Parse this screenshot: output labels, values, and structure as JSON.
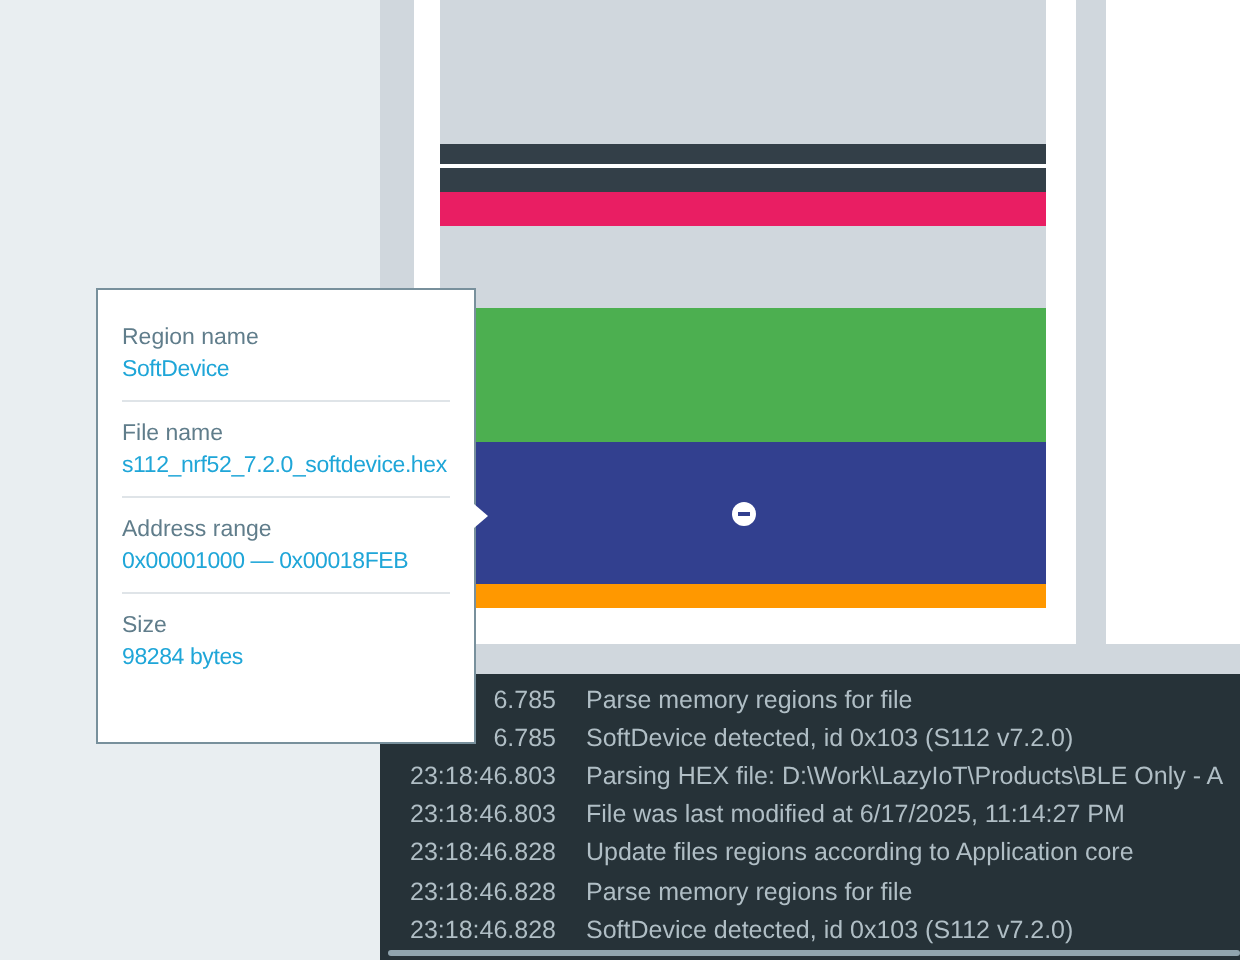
{
  "memory_map": {
    "regions": [
      {
        "kind": "gap",
        "color": "#d0d7dd"
      },
      {
        "kind": "region",
        "color": "#333f48"
      },
      {
        "kind": "region",
        "color": "#333f48"
      },
      {
        "kind": "region",
        "color": "#e91e63"
      },
      {
        "kind": "gap",
        "color": "#d0d7dd"
      },
      {
        "kind": "region",
        "color": "#4caf50"
      },
      {
        "kind": "region",
        "color": "#32408f",
        "selected": true
      },
      {
        "kind": "region",
        "color": "#ff9800"
      },
      {
        "kind": "gap",
        "color": "#ffffff"
      }
    ]
  },
  "tooltip": {
    "fields": [
      {
        "label": "Region name",
        "value": "SoftDevice"
      },
      {
        "label": "File name",
        "value": "s112_nrf52_7.2.0_softdevice.hex"
      },
      {
        "label": "Address range",
        "value": "0x00001000 — 0x00018FEB"
      },
      {
        "label": "Size",
        "value": "98284 bytes"
      }
    ]
  },
  "log": {
    "rows": [
      {
        "time": "6.785",
        "message": "Parse memory regions for file"
      },
      {
        "time": "6.785",
        "message": "SoftDevice detected, id 0x103 (S112 v7.2.0)"
      },
      {
        "time": "23:18:46.803",
        "message": "Parsing HEX file: D:\\Work\\LazyIoT\\Products\\BLE Only - A"
      },
      {
        "time": "23:18:46.803",
        "message": "File was last modified at 6/17/2025, 11:14:27 PM"
      },
      {
        "time": "23:18:46.828",
        "message": "Update files regions according to Application core"
      },
      {
        "time": "23:18:46.828",
        "message": "Parse memory regions for file"
      },
      {
        "time": "23:18:46.828",
        "message": "SoftDevice detected, id 0x103 (S112 v7.2.0)"
      }
    ]
  }
}
